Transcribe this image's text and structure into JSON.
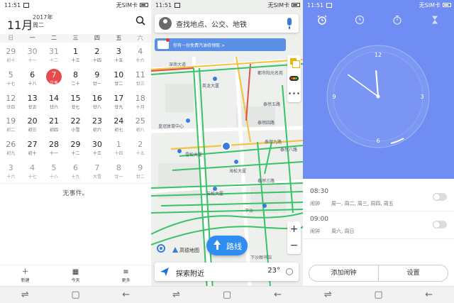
{
  "colors": {
    "today": "#e84b4b",
    "clock_bg": "#6f8df2",
    "route_btn": "#2f8cf0",
    "promo_bg": "#5c8fe6"
  },
  "calendar": {
    "status": {
      "time": "11:51",
      "sim": "无SIM卡"
    },
    "month": "11月",
    "year": "2017年",
    "weekday": "周二",
    "search_icon": "search-icon",
    "weekdays": [
      "日",
      "一",
      "二",
      "三",
      "四",
      "五",
      "六"
    ],
    "weeks": [
      [
        {
          "n": "29",
          "l": "初十",
          "m": true
        },
        {
          "n": "30",
          "l": "十一",
          "m": true
        },
        {
          "n": "31",
          "l": "十二",
          "m": true
        },
        {
          "n": "1",
          "l": "十三"
        },
        {
          "n": "2",
          "l": "十四"
        },
        {
          "n": "3",
          "l": "十五"
        },
        {
          "n": "4",
          "l": "十六"
        }
      ],
      [
        {
          "n": "5",
          "l": "十七"
        },
        {
          "n": "6",
          "l": "十八"
        },
        {
          "n": "7",
          "l": "立冬",
          "today": true
        },
        {
          "n": "8",
          "l": "二十"
        },
        {
          "n": "9",
          "l": "廿一"
        },
        {
          "n": "10",
          "l": "廿二"
        },
        {
          "n": "11",
          "l": "廿三"
        }
      ],
      [
        {
          "n": "12",
          "l": "廿四"
        },
        {
          "n": "13",
          "l": "廿五"
        },
        {
          "n": "14",
          "l": "廿六"
        },
        {
          "n": "15",
          "l": "廿七"
        },
        {
          "n": "16",
          "l": "廿八"
        },
        {
          "n": "17",
          "l": "廿九"
        },
        {
          "n": "18",
          "l": "十月"
        }
      ],
      [
        {
          "n": "19",
          "l": "初二"
        },
        {
          "n": "20",
          "l": "初三"
        },
        {
          "n": "21",
          "l": "初四"
        },
        {
          "n": "22",
          "l": "小雪"
        },
        {
          "n": "23",
          "l": "初六"
        },
        {
          "n": "24",
          "l": "初七"
        },
        {
          "n": "25",
          "l": "初八"
        }
      ],
      [
        {
          "n": "26",
          "l": "初九"
        },
        {
          "n": "27",
          "l": "初十"
        },
        {
          "n": "28",
          "l": "十一"
        },
        {
          "n": "29",
          "l": "十二"
        },
        {
          "n": "30",
          "l": "十三"
        },
        {
          "n": "1",
          "l": "十四",
          "m": true
        },
        {
          "n": "2",
          "l": "十五",
          "m": true
        }
      ],
      [
        {
          "n": "3",
          "l": "十六",
          "m": true
        },
        {
          "n": "4",
          "l": "十七",
          "m": true
        },
        {
          "n": "5",
          "l": "十八",
          "m": true
        },
        {
          "n": "6",
          "l": "十九",
          "m": true
        },
        {
          "n": "7",
          "l": "大雪",
          "m": true
        },
        {
          "n": "8",
          "l": "廿一",
          "m": true
        },
        {
          "n": "9",
          "l": "廿二",
          "m": true
        }
      ]
    ],
    "no_events": "无事件。",
    "bottom": {
      "new": "新建",
      "today": "今天",
      "more": "更多"
    }
  },
  "map": {
    "status": {
      "time": "11:51",
      "sim": "无SIM卡"
    },
    "search_placeholder": "查找地点、公交、地铁",
    "promo": "你有一份免费汽油待领取 >",
    "zoom_in": "+",
    "zoom_out": "−",
    "route_label": "路线",
    "watermark": "高德地图",
    "explore": "探索附近",
    "temperature": "23°",
    "labels": [
      "英龙大厦",
      "都市阳光名苑",
      "泰然五路",
      "皇冠体育中心",
      "泰然四路",
      "雪松大厦",
      "海松大厦",
      "泰然九路",
      "云松大厦",
      "泰然三路",
      "下沙",
      "下沙图书馆",
      "泰然八路",
      "深南大道"
    ]
  },
  "clock": {
    "status": {
      "time": "11:51",
      "sim": "无SIM卡"
    },
    "tabs": [
      "alarm-clock-icon",
      "world-clock-icon",
      "stopwatch-icon",
      "timer-icon"
    ],
    "dial": {
      "n12": "12",
      "n3": "3",
      "n6": "6",
      "n9": "9",
      "hour": 11,
      "minute": 51
    },
    "alarms": [
      {
        "time": "08:30",
        "label": "闹钟",
        "days": "周一, 周二, 周三, 周四, 周五",
        "enabled": false
      },
      {
        "time": "09:00",
        "label": "闹钟",
        "days": "周六, 周日",
        "enabled": false
      }
    ],
    "add_alarm": "添加闹钟",
    "settings": "设置"
  }
}
